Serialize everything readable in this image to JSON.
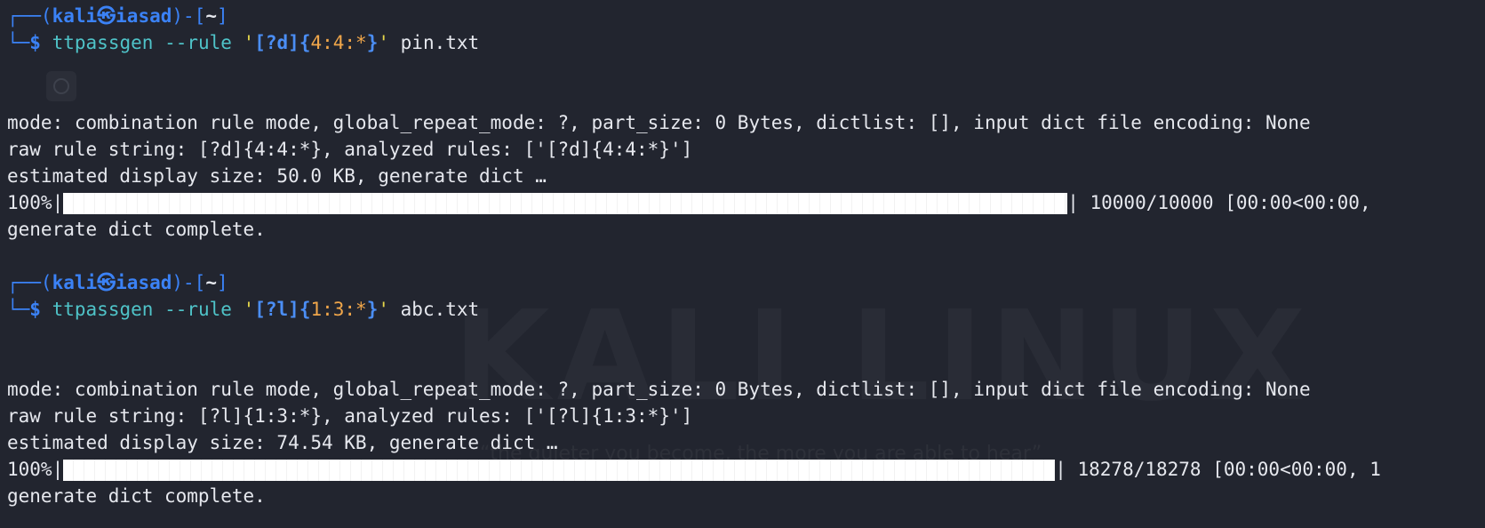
{
  "prompt": {
    "corner_top": "┌──(",
    "user": "kali",
    "sep": "㉿",
    "host": "iasad",
    "mid": ")-[",
    "dir": "~",
    "end": "]",
    "corner_bottom": "└─",
    "dollar": "$"
  },
  "blocks": [
    {
      "cmd": "ttpassgen",
      "opt": "--rule",
      "quote_open": "'",
      "rule_part1": "[?d]",
      "rule_brace_open": "{",
      "rule_part2": "4:4:*",
      "rule_brace_close": "}",
      "quote_close": "'",
      "file": "pin.txt",
      "mode_line": "mode: combination rule mode, global_repeat_mode: ?, part_size: 0 Bytes, dictlist: [], input dict file encoding: None",
      "raw_line": "raw rule string: [?d]{4:4:*}, analyzed rules: ['[?d]{4:4:*}']",
      "estimate_line": "estimated display size: 50.0 KB, generate dict …",
      "progress_prefix": "100%|",
      "progress_suffix": "| 10000/10000 [00:00<00:00,",
      "progress_value": 1.0,
      "complete_line": "generate dict complete."
    },
    {
      "cmd": "ttpassgen",
      "opt": "--rule",
      "quote_open": "'",
      "rule_part1": "[?l]",
      "rule_brace_open": "{",
      "rule_part2": "1:3:*",
      "rule_brace_close": "}",
      "quote_close": "'",
      "file": "abc.txt",
      "mode_line": "mode: combination rule mode, global_repeat_mode: ?, part_size: 0 Bytes, dictlist: [], input dict file encoding: None",
      "raw_line": "raw rule string: [?l]{1:3:*}, analyzed rules: ['[?l]{1:3:*}']",
      "estimate_line": "estimated display size: 74.54 KB, generate dict …",
      "progress_prefix": "100%|",
      "progress_suffix": "| 18278/18278 [00:00<00:00, 1",
      "progress_value": 1.0,
      "complete_line": "generate dict complete."
    }
  ],
  "background": {
    "watermark": "KALI LINUX",
    "quote": "“the quieter you become, the more you are able to hear”"
  },
  "colors": {
    "background": "#22252f",
    "prompt_blue": "#3b82f6",
    "command_cyan": "#4fc3c8",
    "rule_orange": "#f0a64a",
    "text": "#e6e8ee"
  }
}
